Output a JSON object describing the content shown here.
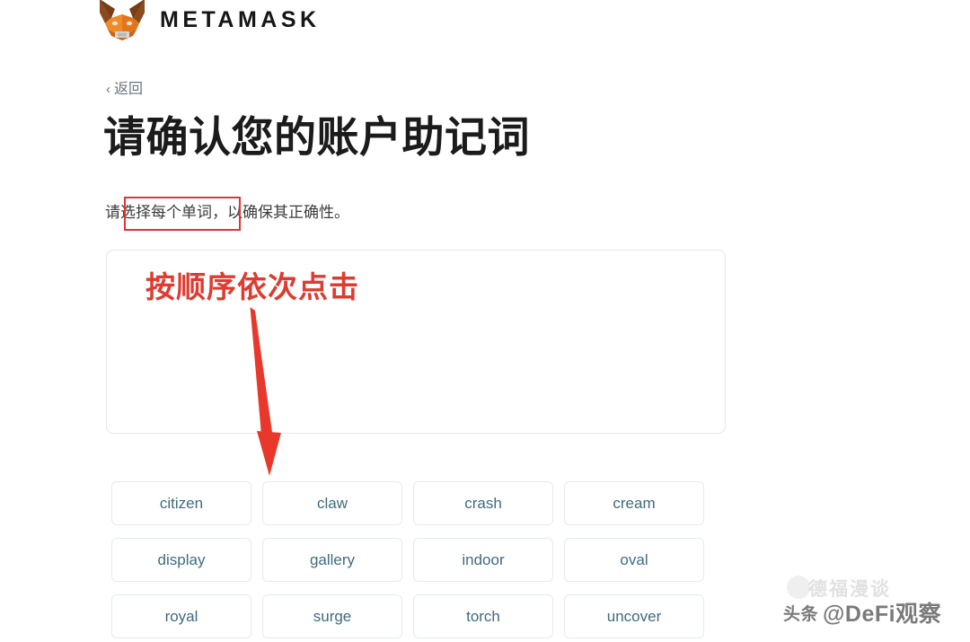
{
  "brand": {
    "name": "METAMASK",
    "logo_icon": "metamask-fox-icon",
    "fox_colors": {
      "face": "#e2761b",
      "ear_dark": "#8c4a21",
      "snout": "#d7d7d7",
      "highlight": "#f6851b"
    }
  },
  "nav": {
    "back_label": "返回",
    "back_chevron": "‹"
  },
  "page": {
    "title": "请确认您的账户助记词",
    "subtitle": "请选择每个单词，以确保其正确性。"
  },
  "dropzone": {
    "selected_words": [],
    "placeholder": ""
  },
  "annotations": {
    "accent_color": "#df3b30",
    "box_color": "#e3342f",
    "arrow_icon": "down-arrow-icon",
    "callout_text": "按顺序依次点击",
    "highlight_box_target": "请选择每个单词"
  },
  "word_bank": {
    "rows": [
      [
        "citizen",
        "claw",
        "crash",
        "cream"
      ],
      [
        "display",
        "gallery",
        "indoor",
        "oval"
      ],
      [
        "royal",
        "surge",
        "torch",
        "uncover"
      ]
    ],
    "words": [
      "citizen",
      "claw",
      "crash",
      "cream",
      "display",
      "gallery",
      "indoor",
      "oval",
      "royal",
      "surge",
      "torch",
      "uncover"
    ],
    "text_color": "#3f6b7d"
  },
  "watermarks": {
    "faded_text": "德福漫谈",
    "main_prefix": "头条",
    "main_handle": "@DeFi观察"
  }
}
